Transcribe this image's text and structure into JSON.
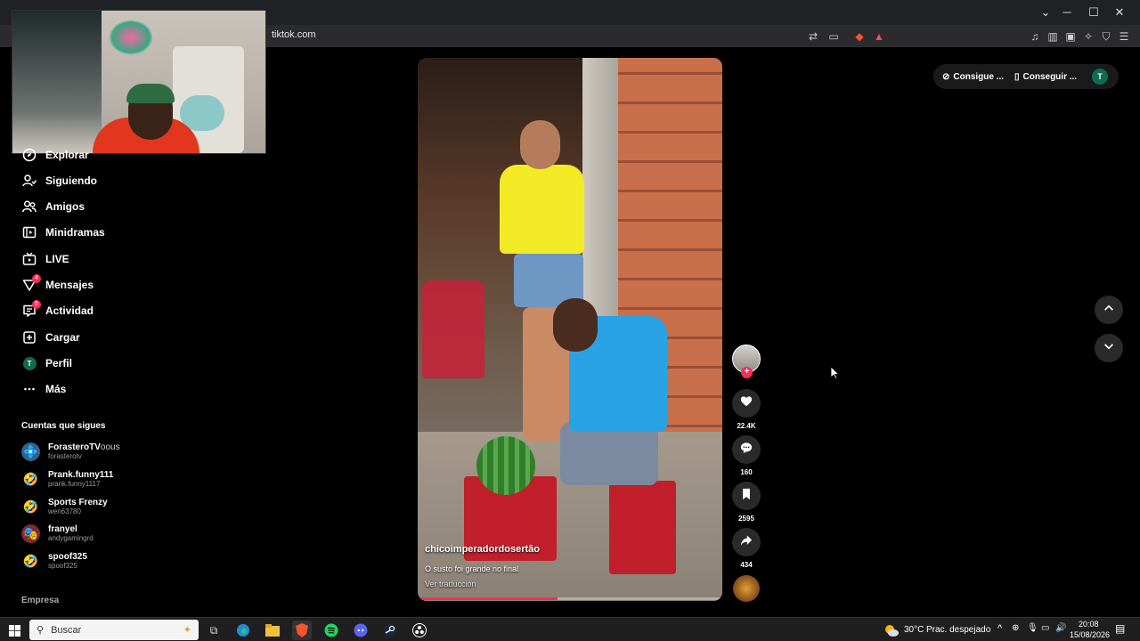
{
  "browser": {
    "url": "tiktok.com",
    "window_controls": {
      "minimize": "─",
      "maximize": "☐",
      "close": "✕",
      "dropdown": "⌄"
    }
  },
  "sidebar": {
    "items": [
      {
        "label": "Explorar",
        "icon": "compass-icon"
      },
      {
        "label": "Siguiendo",
        "icon": "user-follow-icon"
      },
      {
        "label": "Amigos",
        "icon": "friends-icon"
      },
      {
        "label": "Minidramas",
        "icon": "film-icon"
      },
      {
        "label": "LIVE",
        "icon": "live-tv-icon"
      },
      {
        "label": "Mensajes",
        "icon": "send-icon",
        "badge": "4"
      },
      {
        "label": "Actividad",
        "icon": "inbox-icon",
        "badge": "5"
      },
      {
        "label": "Cargar",
        "icon": "upload-plus-icon"
      },
      {
        "label": "Perfil",
        "icon": "profile-avatar",
        "avatar_letter": "T"
      },
      {
        "label": "Más",
        "icon": "more-dots-icon"
      }
    ],
    "following_title": "Cuentas que sigues",
    "following": [
      {
        "name": "ForasteroTV",
        "name_extra": "oous",
        "user": "forasterotv",
        "avatar": "💠"
      },
      {
        "name": "Prank.funny111",
        "user": "prank.funny1117",
        "avatar": "🤣"
      },
      {
        "name": "Sports Frenzy",
        "user": "wen63780",
        "avatar": "🤣"
      },
      {
        "name": "franyel",
        "user": "andygamingrd",
        "avatar": "🎭"
      },
      {
        "name": "spoof325",
        "user": "spoof325",
        "avatar": "🤣"
      }
    ],
    "footer": "Empresa"
  },
  "video": {
    "username": "chicoimperadordosertão",
    "description": "O susto foi grande no final",
    "translate": "Ver traducción",
    "progress": 0.46
  },
  "actions": {
    "likes": "22.4K",
    "comments": "160",
    "saves": "2595",
    "shares": "434"
  },
  "topbar": {
    "get_coins": "Consigue ...",
    "get_app": "Conseguir ...",
    "avatar_letter": "T"
  },
  "taskbar": {
    "search_placeholder": "Buscar",
    "weather": "30°C",
    "weather_desc": "Prac. despejado",
    "time": "20:08",
    "date": "15/08/2026"
  },
  "colors": {
    "accent": "#fe2c55",
    "avatar_green": "#0f6b52"
  }
}
